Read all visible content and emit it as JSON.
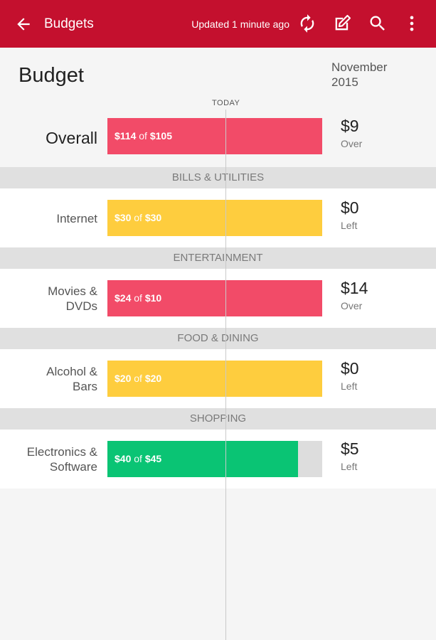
{
  "appbar": {
    "title": "Budgets",
    "updated": "Updated 1 minute ago",
    "icons": [
      "back-arrow-icon",
      "refresh-icon",
      "edit-icon",
      "search-icon",
      "more-vert-icon"
    ],
    "color": "#c4102e"
  },
  "header": {
    "title": "Budget",
    "period_line1": "November",
    "period_line2": "2015",
    "today_label": "TODAY"
  },
  "colors": {
    "over": "#f24b68",
    "exact": "#fecd3e",
    "under": "#0ac474",
    "track": "#dddddd"
  },
  "overall": {
    "label": "Overall",
    "spent": "$114",
    "of": "of",
    "budget": "$105",
    "amount": "$9",
    "status": "Over",
    "fill_fraction": 1.0,
    "state": "over"
  },
  "categories": [
    {
      "section": "BILLS & UTILITIES",
      "label_line1": "Internet",
      "label_line2": "",
      "spent": "$30",
      "of": "of",
      "budget": "$30",
      "amount": "$0",
      "status": "Left",
      "fill_fraction": 1.0,
      "state": "exact"
    },
    {
      "section": "ENTERTAINMENT",
      "label_line1": "Movies &",
      "label_line2": "DVDs",
      "spent": "$24",
      "of": "of",
      "budget": "$10",
      "amount": "$14",
      "status": "Over",
      "fill_fraction": 1.0,
      "state": "over"
    },
    {
      "section": "FOOD & DINING",
      "label_line1": "Alcohol &",
      "label_line2": "Bars",
      "spent": "$20",
      "of": "of",
      "budget": "$20",
      "amount": "$0",
      "status": "Left",
      "fill_fraction": 1.0,
      "state": "exact"
    },
    {
      "section": "SHOPPING",
      "label_line1": "Electronics &",
      "label_line2": "Software",
      "spent": "$40",
      "of": "of",
      "budget": "$45",
      "amount": "$5",
      "status": "Left",
      "fill_fraction": 0.889,
      "state": "under"
    }
  ]
}
